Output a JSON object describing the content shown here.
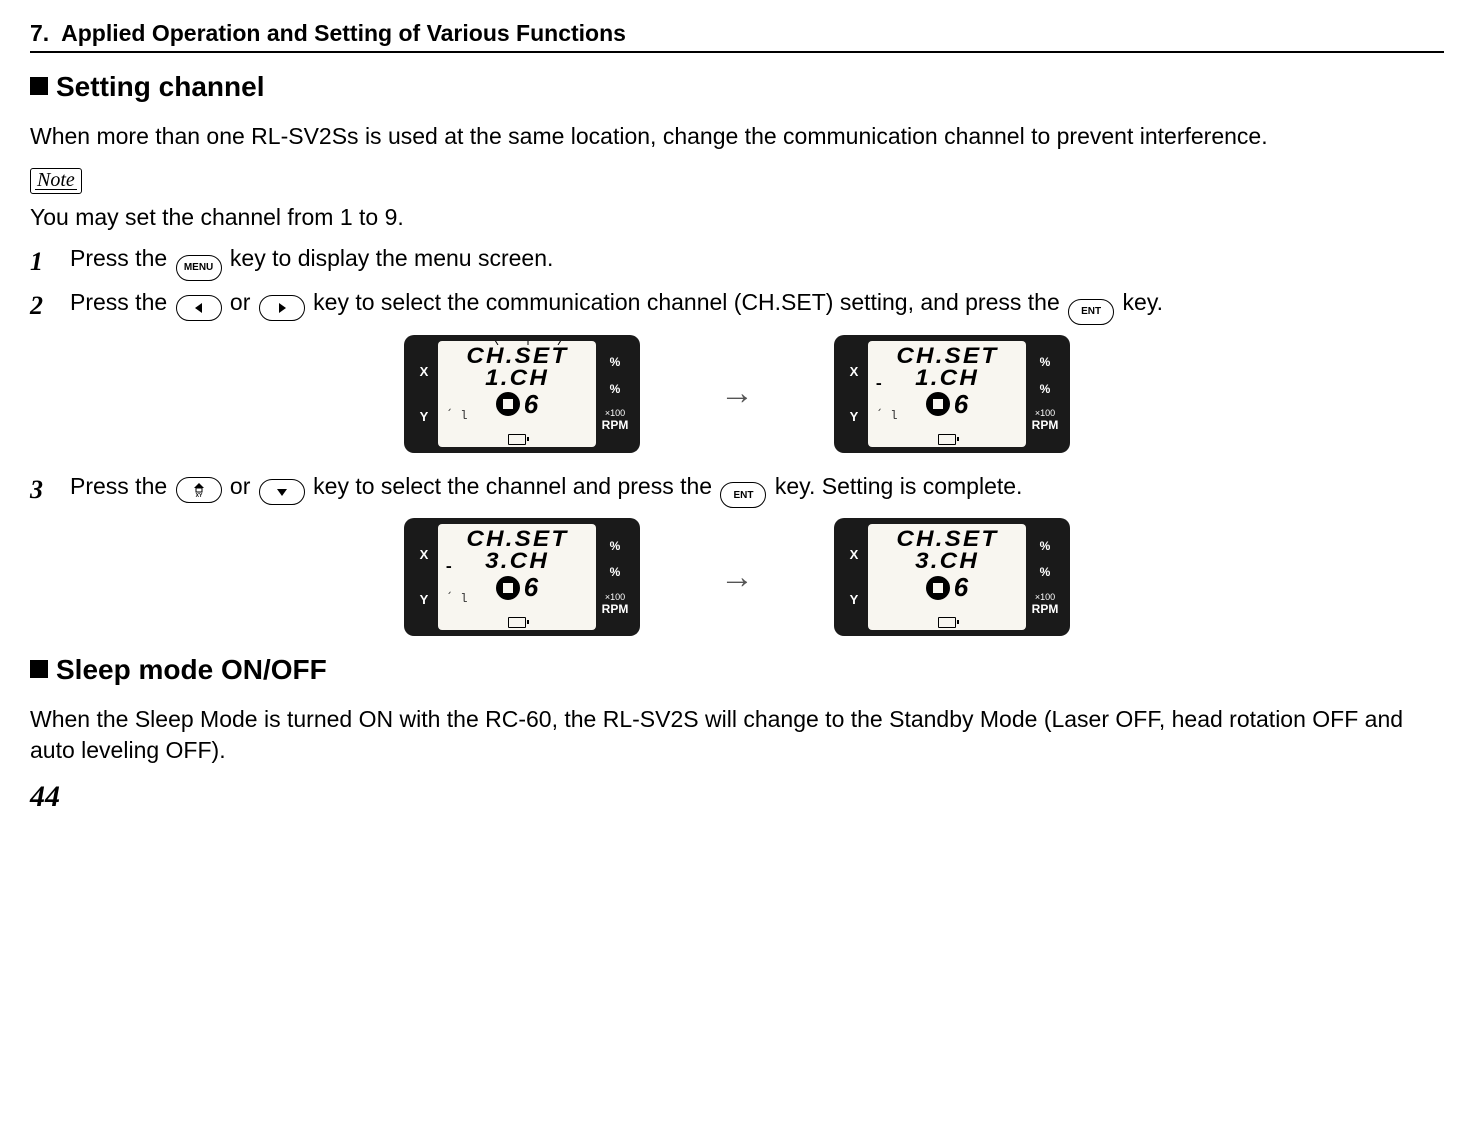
{
  "chapter": {
    "num": "7.",
    "title": "Applied Operation and Setting of Various Functions"
  },
  "section1": {
    "title": "Setting channel",
    "intro": "When more than one RL-SV2Ss is used at the same location, change the communication channel to prevent interference.",
    "note_label": "Note",
    "note_text": "You may set the channel from 1 to 9.",
    "step1": {
      "num": "1",
      "pre": "Press the ",
      "key1": "MENU",
      "post": " key to display the menu screen."
    },
    "step2": {
      "num": "2",
      "pre": "Press the ",
      "mid1": " or ",
      "mid2": " key to select the communication channel (CH.SET) setting, and press the ",
      "key_ent": "ENT",
      "post": " key."
    },
    "step3": {
      "num": "3",
      "pre": "Press the ",
      "mid1": " or ",
      "mid2": " key to select the channel and press the ",
      "key_ent": "ENT",
      "post": " key. Setting is complete."
    }
  },
  "lcd_labels": {
    "x": "X",
    "y": "Y",
    "pct": "%",
    "x100": "×100",
    "rpm": "RPM"
  },
  "lcd_screens": {
    "row1": {
      "left": {
        "top": "CH.SET",
        "mid": "1.CH",
        "minus": false,
        "six": "6"
      },
      "right": {
        "top": "CH.SET",
        "mid": "1.CH",
        "minus": true,
        "six": "6"
      }
    },
    "row2": {
      "left": {
        "top": "CH.SET",
        "mid": "3.CH",
        "minus": true,
        "six": "6"
      },
      "right": {
        "top": "CH.SET",
        "mid": "3.CH",
        "minus": false,
        "six": "6"
      }
    }
  },
  "section2": {
    "title": "Sleep mode ON/OFF",
    "intro": "When the Sleep Mode is turned ON with the RC-60, the RL-SV2S will change to the Standby Mode (Laser OFF, head rotation OFF and auto leveling OFF)."
  },
  "page_number": "44"
}
